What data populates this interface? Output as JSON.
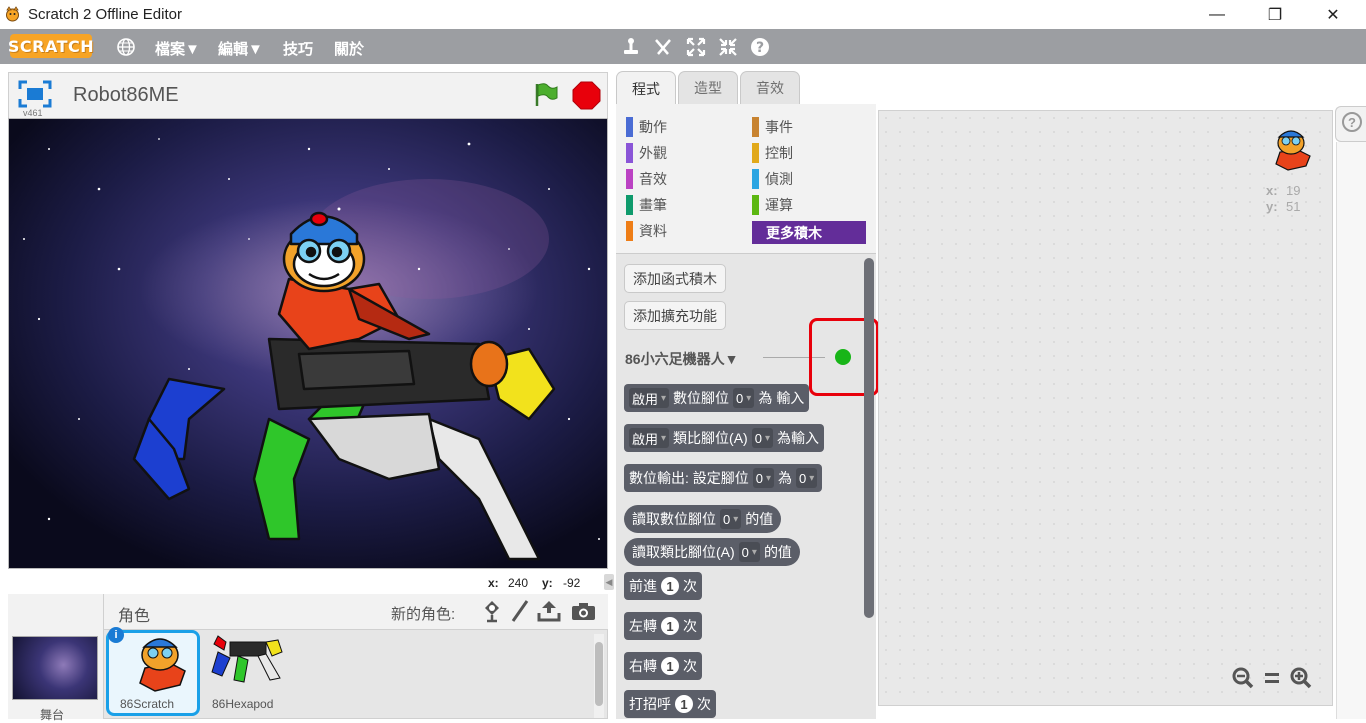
{
  "window": {
    "title": "Scratch 2 Offline Editor",
    "minimize": "—",
    "restore": "❐",
    "close": "✕"
  },
  "menubar": {
    "logo": "SCRATCH",
    "file": "檔案▼",
    "edit": "編輯▼",
    "tips": "技巧",
    "about": "關於"
  },
  "stage": {
    "project_name": "Robot86ME",
    "version": "v461",
    "x_label": "x:",
    "x_value": "240",
    "y_label": "y:",
    "y_value": "-92"
  },
  "sprites": {
    "header_label": "角色",
    "new_sprite_label": "新的角色:",
    "stage_label": "舞台",
    "items": [
      {
        "name": "86Scratch"
      },
      {
        "name": "86Hexapod"
      }
    ]
  },
  "tabs": [
    {
      "label": "程式"
    },
    {
      "label": "造型"
    },
    {
      "label": "音效"
    }
  ],
  "categories": {
    "left": [
      {
        "label": "動作",
        "color": "#4a6cd4"
      },
      {
        "label": "外觀",
        "color": "#8a55d7"
      },
      {
        "label": "音效",
        "color": "#bb42c3"
      },
      {
        "label": "畫筆",
        "color": "#0e9a6c"
      },
      {
        "label": "資料",
        "color": "#ee7d16"
      }
    ],
    "right": [
      {
        "label": "事件",
        "color": "#c88330"
      },
      {
        "label": "控制",
        "color": "#e1a91a"
      },
      {
        "label": "偵測",
        "color": "#2ca5e2"
      },
      {
        "label": "運算",
        "color": "#5cb712"
      },
      {
        "label": "更多積木",
        "color": "#632d99"
      }
    ]
  },
  "palette": {
    "add_block_button": "添加函式積木",
    "add_extension_button": "添加擴充功能",
    "extension_name": "86小六足機器人▼",
    "blocks": [
      {
        "parts": [
          "啟用",
          "數位腳位",
          "0",
          "為",
          "輸入"
        ]
      },
      {
        "parts": [
          "啟用",
          "類比腳位(A)",
          "0",
          "為輸入"
        ]
      },
      {
        "parts": [
          "數位輸出: 設定腳位",
          "0",
          "為",
          "0"
        ]
      },
      {
        "parts": [
          "讀取數位腳位",
          "0",
          "的值"
        ]
      },
      {
        "parts": [
          "讀取類比腳位(A)",
          "0",
          "的值"
        ]
      },
      {
        "parts": [
          "前進",
          "1",
          "次"
        ]
      },
      {
        "parts": [
          "左轉",
          "1",
          "次"
        ]
      },
      {
        "parts": [
          "右轉",
          "1",
          "次"
        ]
      },
      {
        "parts": [
          "打招呼",
          "1",
          "次"
        ]
      }
    ]
  },
  "scripts": {
    "sprite_x_label": "x:",
    "sprite_x": "19",
    "sprite_y_label": "y:",
    "sprite_y": "51",
    "help_icon": "?"
  },
  "colors": {
    "menubar": "#9c9ea2",
    "logo": "#f7a425",
    "block": "#5b5e68",
    "highlight": "#e8000b",
    "status_dot": "#18b518",
    "more_blocks": "#632d99"
  }
}
